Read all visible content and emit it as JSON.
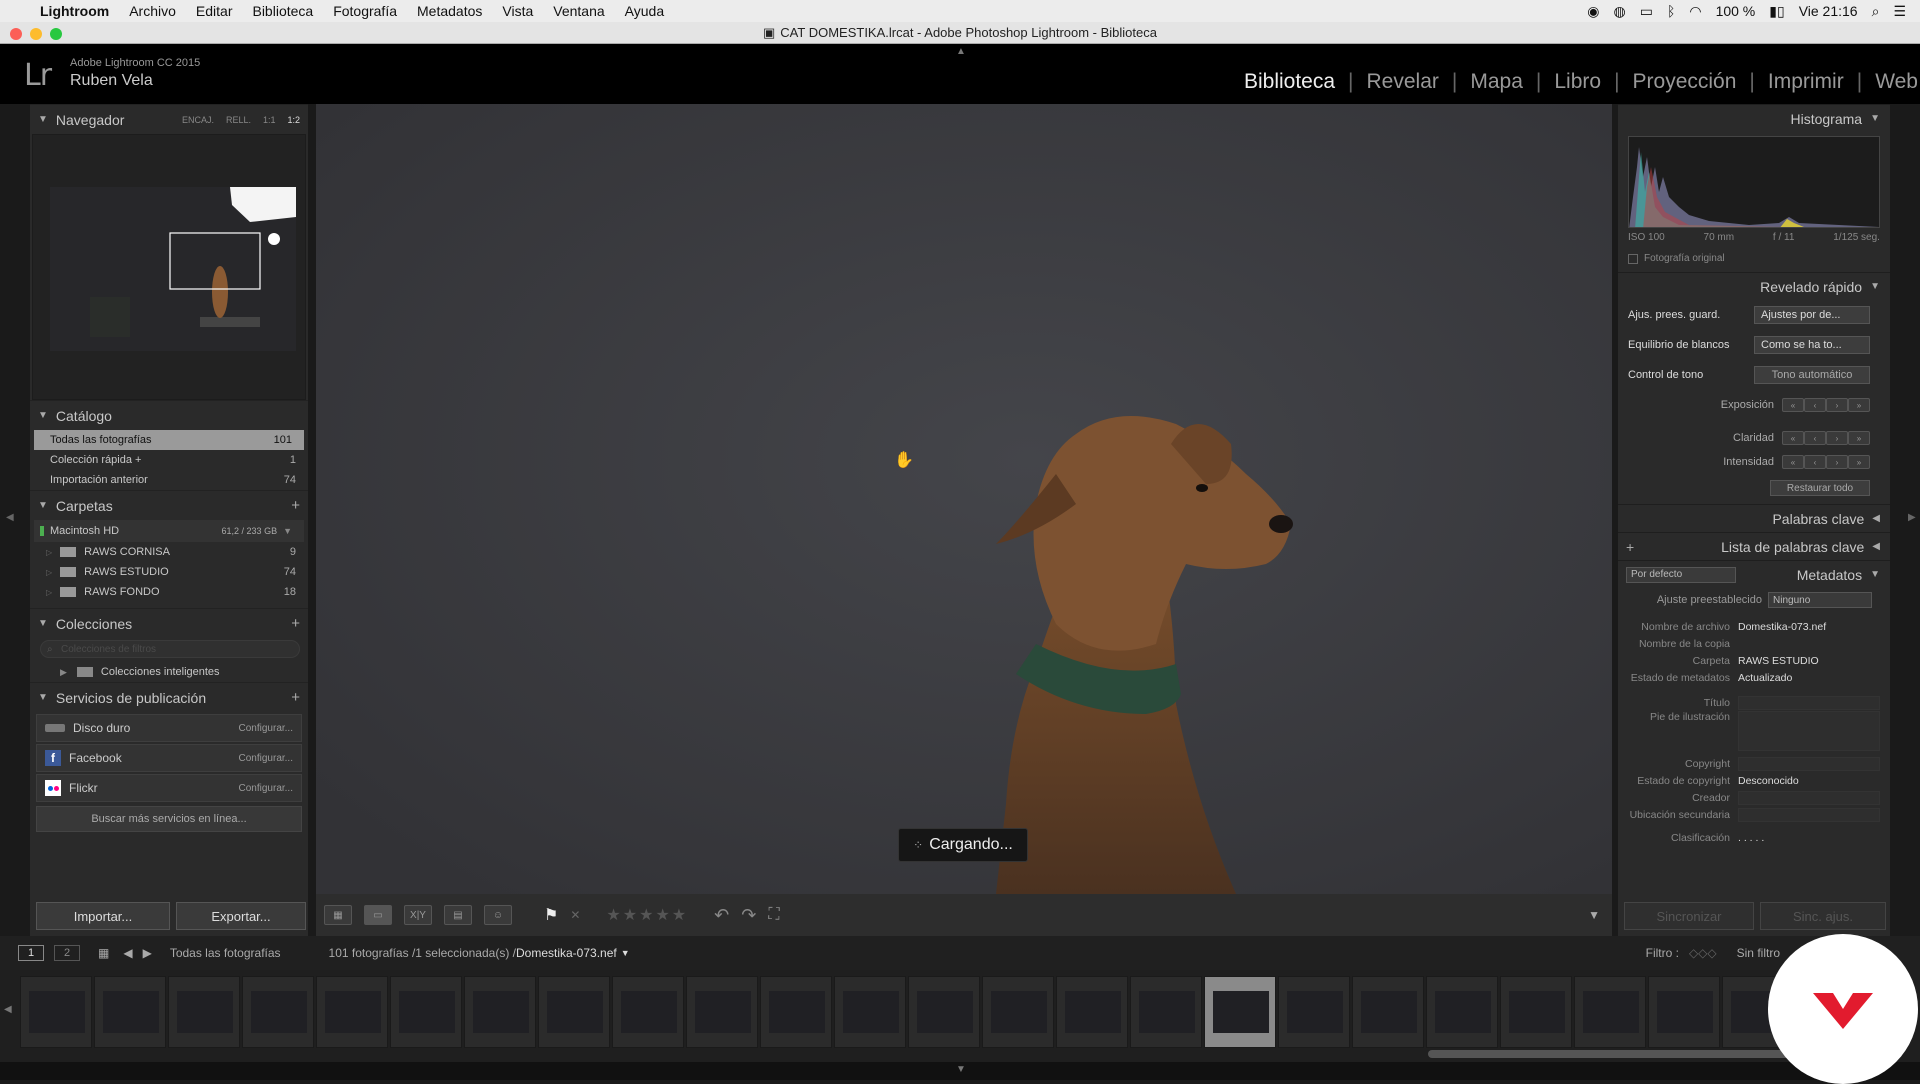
{
  "mac_menu": {
    "apple": "",
    "items": [
      "Lightroom",
      "Archivo",
      "Editar",
      "Biblioteca",
      "Fotografía",
      "Metadatos",
      "Vista",
      "Ventana",
      "Ayuda"
    ],
    "battery": "100 %",
    "clock": "Vie 21:16"
  },
  "window_title": "CAT DOMESTIKA.lrcat - Adobe Photoshop Lightroom - Biblioteca",
  "identity": {
    "logo": "Lr",
    "version": "Adobe Lightroom CC 2015",
    "user": "Ruben Vela"
  },
  "modules": [
    "Biblioteca",
    "Revelar",
    "Mapa",
    "Libro",
    "Proyección",
    "Imprimir",
    "Web"
  ],
  "navigator": {
    "title": "Navegador",
    "zoom": [
      "ENCAJ.",
      "RELL.",
      "1:1",
      "1:2"
    ]
  },
  "catalog": {
    "title": "Catálogo",
    "items": [
      {
        "label": "Todas las fotografías",
        "count": "101"
      },
      {
        "label": "Colección rápida +",
        "count": "1"
      },
      {
        "label": "Importación anterior",
        "count": "74"
      }
    ]
  },
  "folders": {
    "title": "Carpetas",
    "volume": "Macintosh HD",
    "volume_size": "61,2 / 233 GB",
    "items": [
      {
        "label": "RAWS CORNISA",
        "count": "9"
      },
      {
        "label": "RAWS ESTUDIO",
        "count": "74"
      },
      {
        "label": "RAWS FONDO",
        "count": "18"
      }
    ]
  },
  "collections": {
    "title": "Colecciones",
    "filter_placeholder": "Colecciones de filtros",
    "smart": "Colecciones inteligentes"
  },
  "publish": {
    "title": "Servicios de publicación",
    "items": [
      {
        "label": "Disco duro",
        "action": "Configurar..."
      },
      {
        "label": "Facebook",
        "action": "Configurar..."
      },
      {
        "label": "Flickr",
        "action": "Configurar..."
      }
    ],
    "more": "Buscar más servicios en línea..."
  },
  "left_buttons": {
    "import": "Importar...",
    "export": "Exportar..."
  },
  "loading": "Cargando...",
  "histogram": {
    "title": "Histograma",
    "iso": "ISO 100",
    "focal": "70 mm",
    "aperture": "f / 11",
    "shutter": "1/125 seg.",
    "original": "Fotografía original"
  },
  "quick_develop": {
    "title": "Revelado rápido",
    "preset_label": "Ajus. prees. guard.",
    "preset_value": "Ajustes por de...",
    "wb_label": "Equilibrio de blancos",
    "wb_value": "Como se ha to...",
    "tone_label": "Control de tono",
    "tone_value": "Tono automático",
    "exposure": "Exposición",
    "clarity": "Claridad",
    "vibrance": "Intensidad",
    "reset": "Restaurar todo"
  },
  "keywords": {
    "title": "Palabras clave",
    "list_title": "Lista de palabras clave"
  },
  "metadata": {
    "title": "Metadatos",
    "view": "Por defecto",
    "preset_label": "Ajuste preestablecido",
    "preset_value": "Ninguno",
    "fields": [
      {
        "k": "Nombre de archivo",
        "v": "Domestika-073.nef"
      },
      {
        "k": "Nombre de la copia",
        "v": ""
      },
      {
        "k": "Carpeta",
        "v": "RAWS ESTUDIO"
      },
      {
        "k": "Estado de metadatos",
        "v": "Actualizado"
      }
    ],
    "fields2": [
      {
        "k": "Título",
        "v": ""
      },
      {
        "k": "Pie de ilustración",
        "v": ""
      }
    ],
    "fields3": [
      {
        "k": "Copyright",
        "v": ""
      },
      {
        "k": "Estado de copyright",
        "v": "Desconocido"
      },
      {
        "k": "Creador",
        "v": ""
      },
      {
        "k": "Ubicación secundaria",
        "v": ""
      },
      {
        "k": "Clasificación",
        "v": ". . . . ."
      }
    ]
  },
  "right_buttons": {
    "sync": "Sincronizar",
    "sync_settings": "Sinc. ajus."
  },
  "status": {
    "screen1": "1",
    "screen2": "2",
    "source": "Todas las fotografías",
    "count": "101 fotografías /1 seleccionada(s) /",
    "file": "Domestika-073.nef",
    "filter": "Filtro :",
    "filter_value": "Sin filtro"
  },
  "filmstrip": {
    "thumbs": 25,
    "selected_index": 16
  }
}
